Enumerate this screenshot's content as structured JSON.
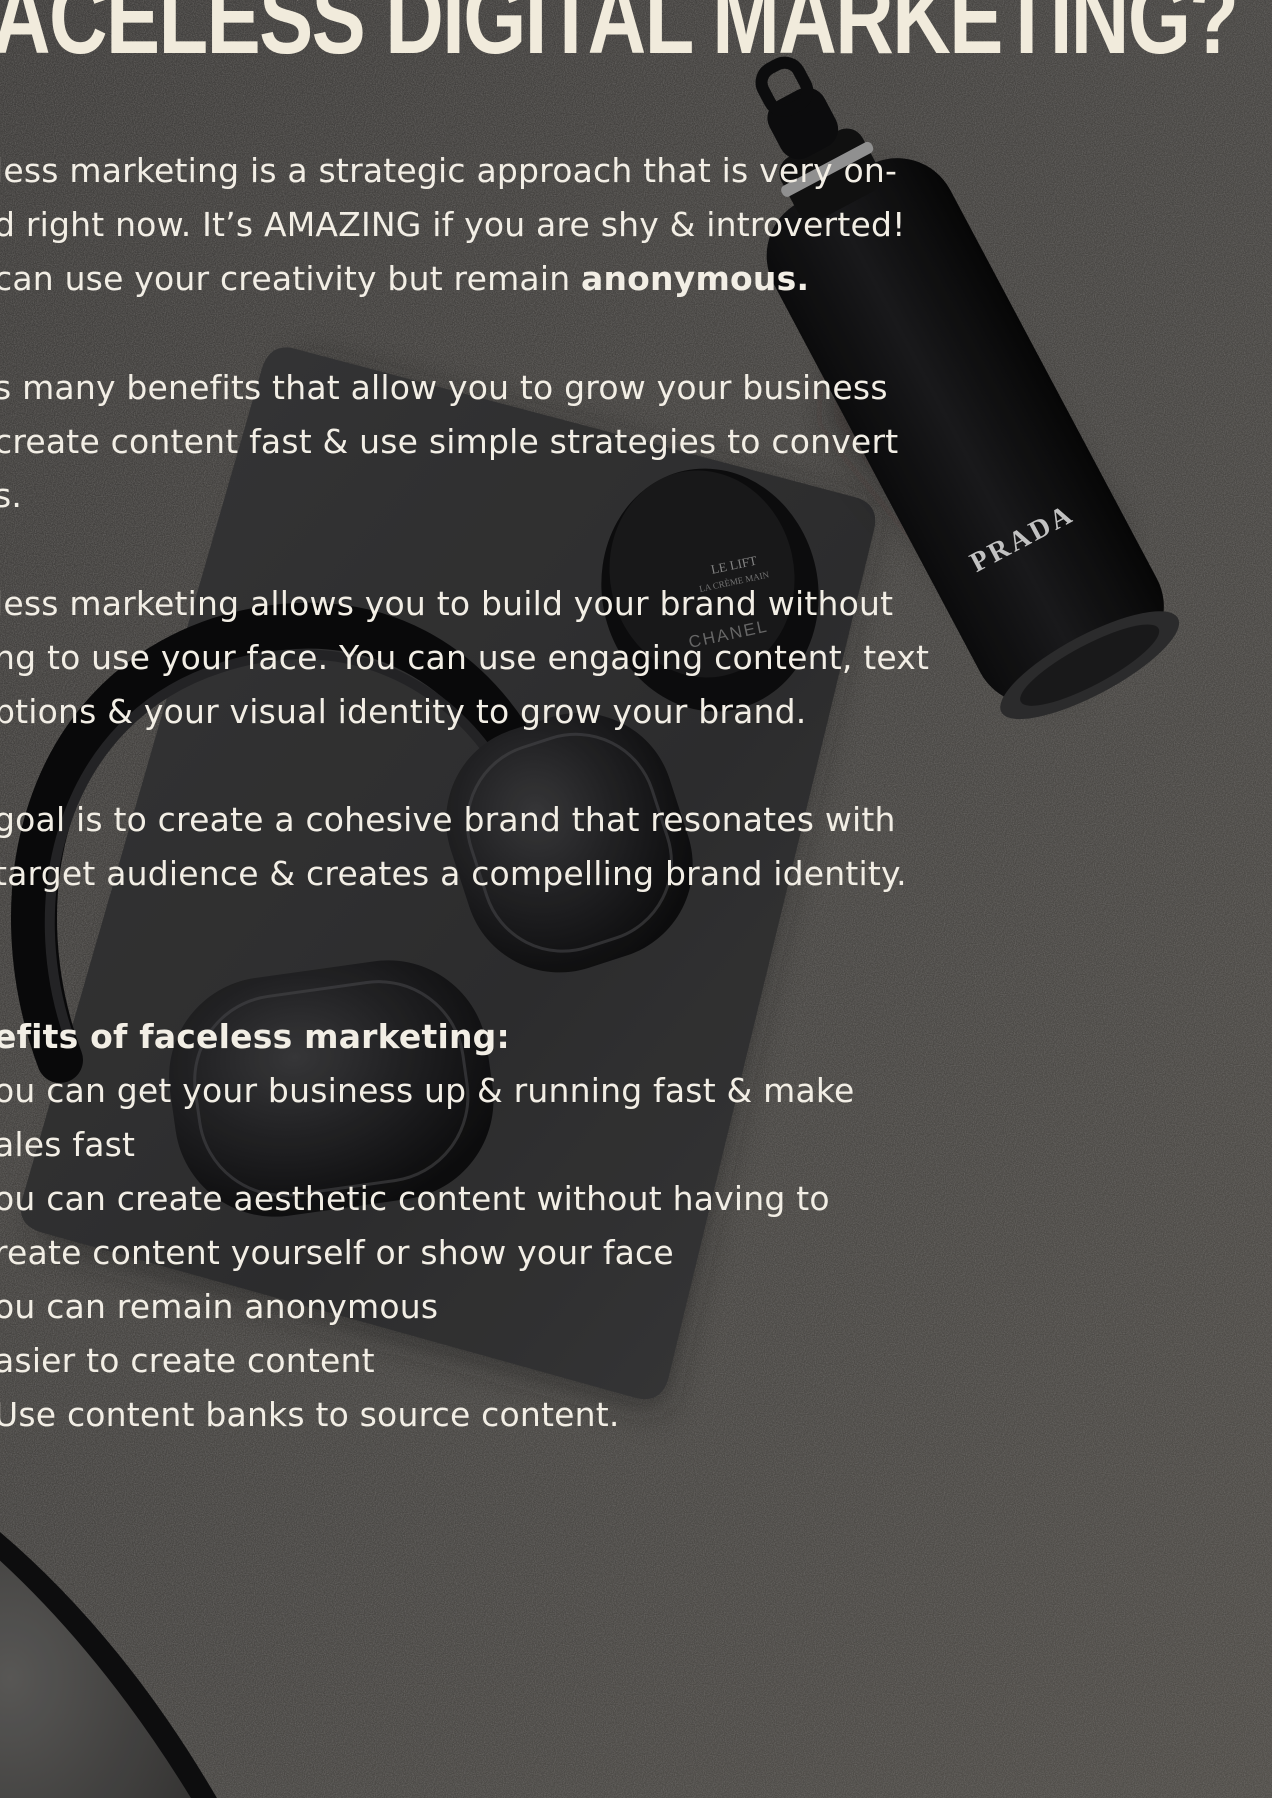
{
  "heading": "ACELESS DIGITAL MARKETING?",
  "paragraphs": [
    {
      "lines": [
        "less marketing is a strategic approach that is very on-",
        "d right now. It’s AMAZING if you are shy & introverted!",
        "can use your creativity but remain "
      ],
      "bold_tail": "anonymous."
    },
    {
      "lines": [
        "s many benefits that allow you to grow your business",
        " create content fast & use simple strategies to convert",
        "s."
      ]
    },
    {
      "lines": [
        "less marketing allows you to build your brand without",
        "ng to use your face. You can use engaging content, text",
        "ptions & your visual identity to grow your brand."
      ]
    },
    {
      "lines": [
        "goal is to create a cohesive brand that resonates with",
        " target audience & creates a compelling brand identity."
      ]
    }
  ],
  "benefits": {
    "title": "efits of faceless marketing:",
    "lines": [
      "ou can get your business up & running fast & make",
      "ales fast",
      "ou can create aesthetic content without having to",
      "reate content yourself or show your face",
      "ou can remain anonymous",
      "asier to create content",
      "Use content banks to source content."
    ]
  },
  "photo_labels": {
    "bottle_brand": "PRADA",
    "case_brand": "CHANEL",
    "case_text_1": "LE LIFT",
    "case_text_2": "LA CRÈME MAIN"
  }
}
